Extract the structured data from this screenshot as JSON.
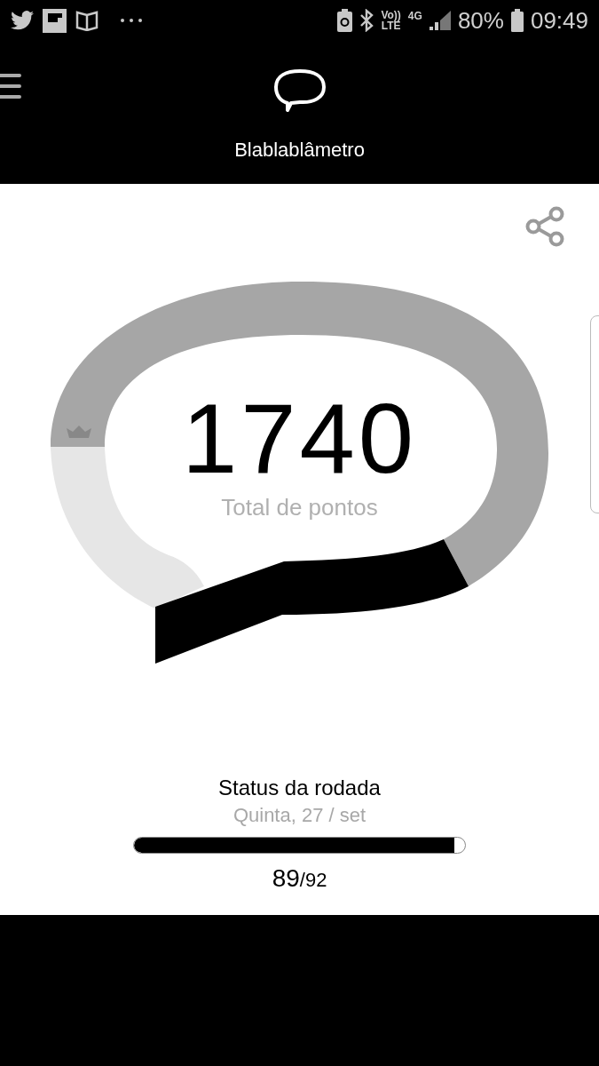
{
  "status_bar": {
    "network_top": "Vo))",
    "network_bottom": "LTE",
    "data_type": "4G",
    "battery": "80%",
    "time": "09:49"
  },
  "header": {
    "title": "Blablablâmetro"
  },
  "score": {
    "value": "1740",
    "caption": "Total de pontos"
  },
  "round_status": {
    "title": "Status da rodada",
    "date": "Quinta, 27 / set",
    "level": 0.967,
    "count": "89",
    "total": "/92"
  }
}
